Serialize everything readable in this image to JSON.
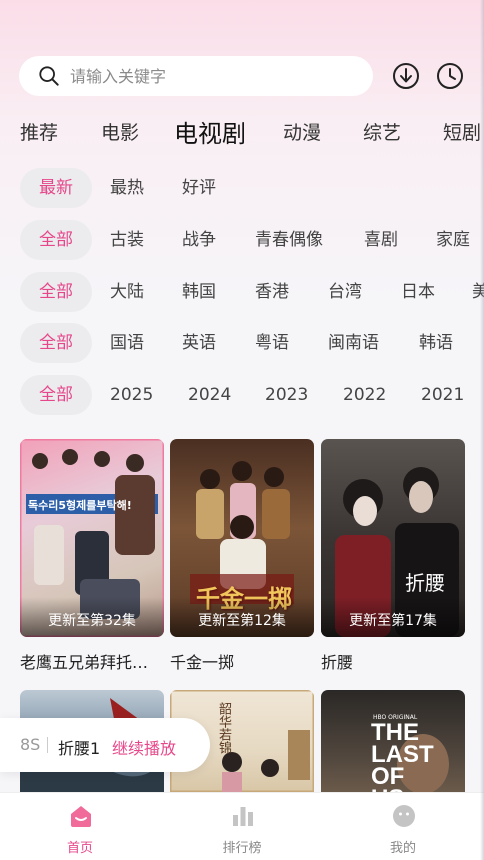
{
  "search": {
    "placeholder": "请输入关键字"
  },
  "category_tabs": [
    "推荐",
    "电影",
    "电视剧",
    "动漫",
    "综艺",
    "短剧"
  ],
  "active_category": "电视剧",
  "filters": {
    "sort": [
      "最新",
      "最热",
      "好评"
    ],
    "genre": [
      "全部",
      "古装",
      "战争",
      "青春偶像",
      "喜剧",
      "家庭"
    ],
    "region": [
      "全部",
      "大陆",
      "韩国",
      "香港",
      "台湾",
      "日本",
      "美"
    ],
    "language": [
      "全部",
      "国语",
      "英语",
      "粤语",
      "闽南语",
      "韩语"
    ],
    "year": [
      "全部",
      "2025",
      "2024",
      "2023",
      "2022",
      "2021"
    ]
  },
  "cards": [
    {
      "title": "老鹰五兄弟拜托…",
      "badge": "更新至第32集",
      "poster_text": "독수리5형제를부탁해!"
    },
    {
      "title": "千金一掷",
      "badge": "更新至第12集",
      "poster_text": "千金一掷"
    },
    {
      "title": "折腰",
      "badge": "更新至第17集",
      "poster_text": "折腰"
    }
  ],
  "cards_row2": [
    {
      "poster_text": ""
    },
    {
      "poster_text": "韶华若锦"
    },
    {
      "poster_text": "THE LAST OF US",
      "poster_small": "HBO ORIGINAL"
    }
  ],
  "continue_watching": {
    "prefix": "8S",
    "name": "折腰1",
    "action": "继续播放"
  },
  "bottom_nav": [
    {
      "label": "首页",
      "icon": "home-icon"
    },
    {
      "label": "排行榜",
      "icon": "chart-icon"
    },
    {
      "label": "我的",
      "icon": "profile-icon"
    }
  ],
  "colors": {
    "accent": "#e6478a",
    "background": "#f6f5f8",
    "chip": "#ececef"
  }
}
